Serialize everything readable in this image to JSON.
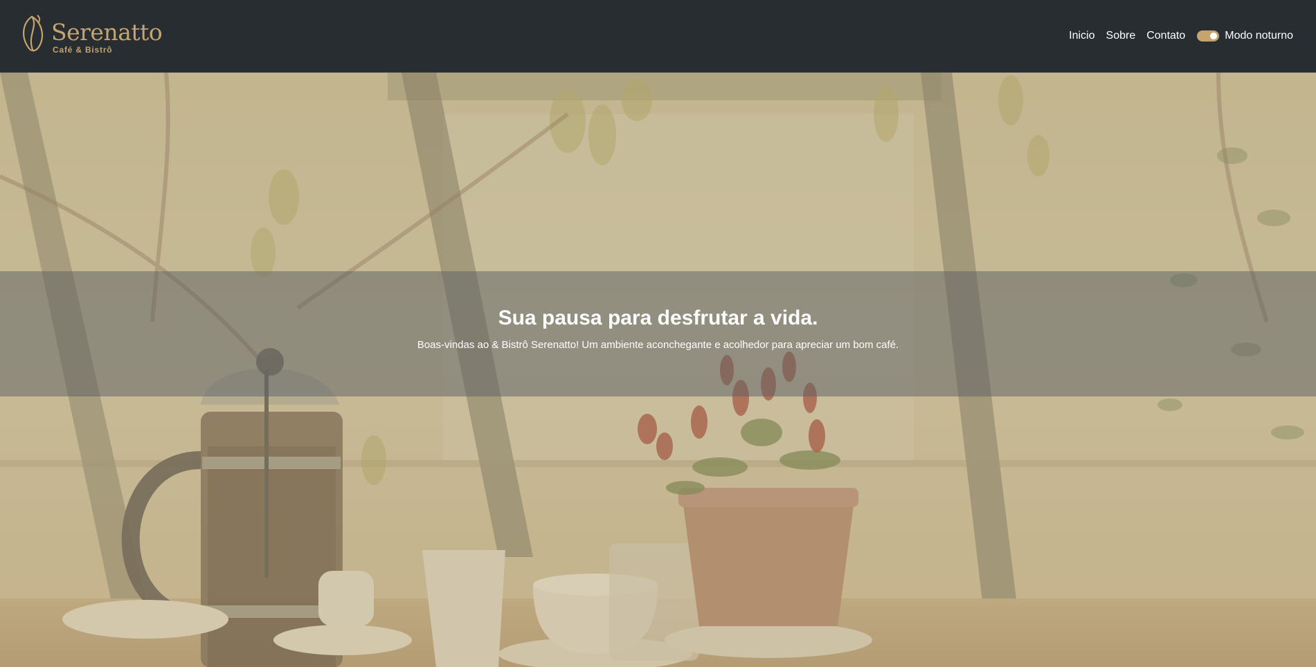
{
  "header": {
    "brand": {
      "name": "Serenatto",
      "tagline": "Café & Bistrô",
      "logo_icon": "coffee-bean-leaf-icon"
    },
    "nav": [
      {
        "label": "Inicio"
      },
      {
        "label": "Sobre"
      },
      {
        "label": "Contato"
      }
    ],
    "theme_toggle": {
      "label": "Modo noturno",
      "state": "on"
    }
  },
  "hero": {
    "title": "Sua pausa para desfrutar a vida.",
    "subtitle": "Boas-vindas ao & Bistrô Serenatto! Um ambiente aconchegante e acolhedor para apreciar um bom café."
  },
  "colors": {
    "header_bg": "#282d31",
    "accent": "#c5a46d",
    "text_light": "#ffffff",
    "hero_overlay": "#c9b994"
  }
}
